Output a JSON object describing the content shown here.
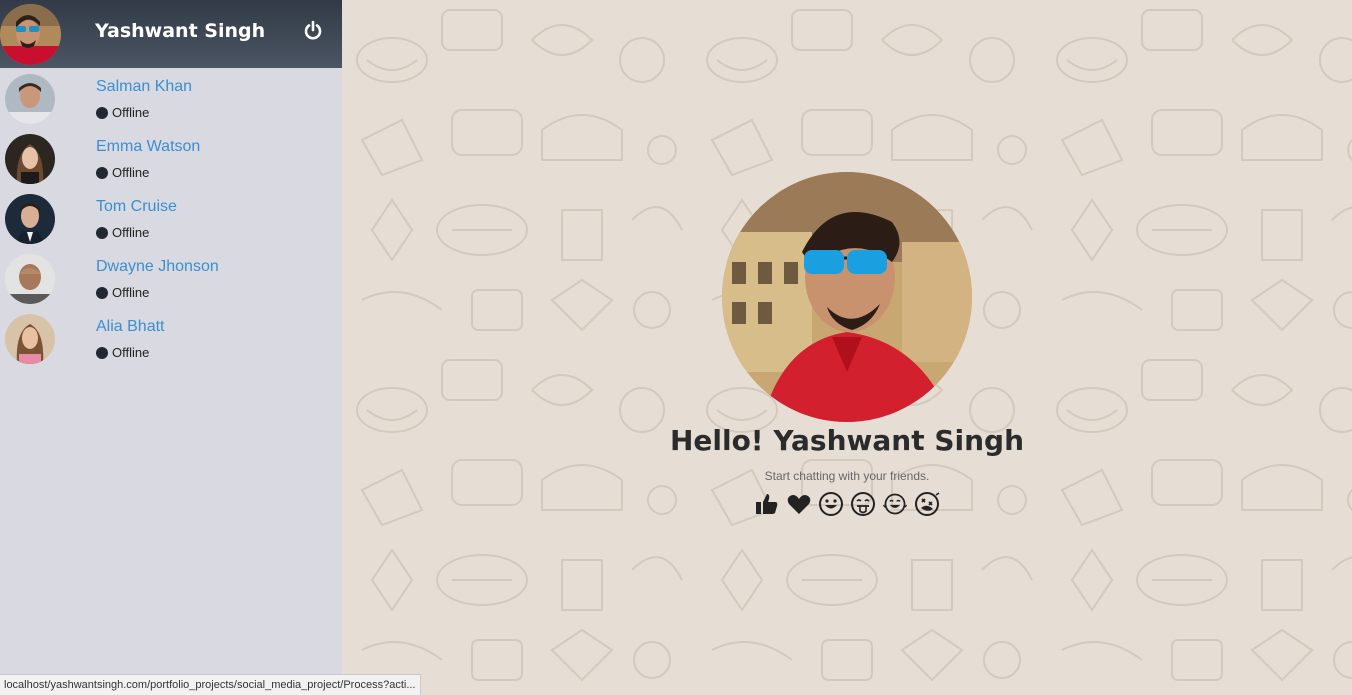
{
  "me": {
    "name": "Yashwant Singh"
  },
  "contacts": [
    {
      "name": "Salman Khan",
      "status": "Offline"
    },
    {
      "name": "Emma Watson",
      "status": "Offline"
    },
    {
      "name": "Tom Cruise",
      "status": "Offline"
    },
    {
      "name": "Dwayne Jhonson",
      "status": "Offline"
    },
    {
      "name": "Alia Bhatt",
      "status": "Offline"
    }
  ],
  "welcome": {
    "title": "Hello! Yashwant Singh",
    "subtitle": "Start chatting with your friends."
  },
  "emojis": [
    "thumbs-up-icon",
    "heart-icon",
    "grinning-face-icon",
    "tongue-face-icon",
    "laughing-face-icon",
    "rofl-face-icon"
  ],
  "status_bar": {
    "url": "localhost/yashwantsingh.com/portfolio_projects/social_media_project/Process?acti..."
  },
  "colors": {
    "header_bg": "#3a4250",
    "sidebar_bg": "#d9d9e1",
    "contact_name": "#3a8fd2",
    "main_bg": "#e6ddd4"
  }
}
